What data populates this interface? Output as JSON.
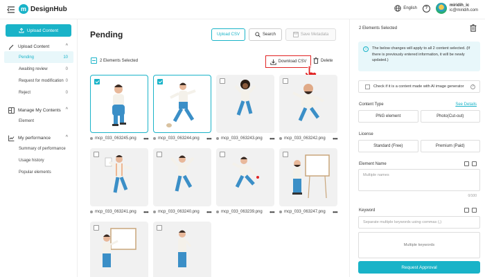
{
  "app": {
    "logo_letter": "m",
    "name": "DesignHub"
  },
  "topbar": {
    "language": "English",
    "help_symbol": "?",
    "user_name": "miridih_ic",
    "user_email": "ic@miridih.com"
  },
  "sidebar": {
    "upload_button": "Upload Content",
    "groups": [
      {
        "label": "Upload Content",
        "icon": "pencil-icon",
        "chevron": "^",
        "items": [
          {
            "label": "Pending",
            "count": "10",
            "active": true
          },
          {
            "label": "Awaiting review",
            "count": "0"
          },
          {
            "label": "Request for modification",
            "count": "0"
          },
          {
            "label": "Reject",
            "count": "0"
          }
        ]
      },
      {
        "label": "Manage My Contents",
        "icon": "grid-icon",
        "chevron": "^",
        "items": [
          {
            "label": "Element"
          }
        ]
      },
      {
        "label": "My performance",
        "icon": "chart-icon",
        "chevron": "^",
        "items": [
          {
            "label": "Summary of performance"
          },
          {
            "label": "Usage history"
          },
          {
            "label": "Popular elements"
          }
        ]
      }
    ]
  },
  "main": {
    "title": "Pending",
    "upload_csv": "Upload CSV",
    "search": "Search",
    "save_metadata": "Save Metadata",
    "selected_text": "2 Elements Selected",
    "download_csv": "Download CSV",
    "delete": "Delete",
    "more_symbol": "•••",
    "items": [
      {
        "file": "mcp_033_063245.png",
        "selected": true
      },
      {
        "file": "mcp_033_063244.png",
        "selected": true
      },
      {
        "file": "mcp_033_063243.png",
        "selected": false
      },
      {
        "file": "mcp_033_063242.png",
        "selected": false
      },
      {
        "file": "mcp_033_063241.png",
        "selected": false
      },
      {
        "file": "mcp_033_063240.png",
        "selected": false
      },
      {
        "file": "mcp_033_063239.png",
        "selected": false
      },
      {
        "file": "mcp_033_063247.png",
        "selected": false
      },
      {
        "file": "",
        "selected": false
      },
      {
        "file": "",
        "selected": false
      }
    ]
  },
  "panel": {
    "header": "2 Elements Selected",
    "info_icon": "i",
    "info_text": "The below changes will apply to all 2 content selected. (If there is previously entered information, it will be newly updated.)",
    "ai_check": "Check if it is a content made with AI image generator",
    "help_symbol": "?",
    "content_type_label": "Content Type",
    "see_details": "See Details",
    "content_types": [
      "PNG element",
      "Photo(Cut-out)"
    ],
    "license_label": "License",
    "licenses": [
      "Standard (Free)",
      "Premium (Paid)"
    ],
    "element_name_label": "Element Name",
    "element_name_placeholder": "Multiple names",
    "element_name_counter": "0/100",
    "keyword_label": "Keyword",
    "keyword_placeholder": "Separate multiple keywords using commas (,)",
    "keyword_value": "Multiple keywords",
    "request_button": "Request Approval"
  },
  "colors": {
    "accent": "#19b3c8",
    "highlight": "#e12222"
  }
}
